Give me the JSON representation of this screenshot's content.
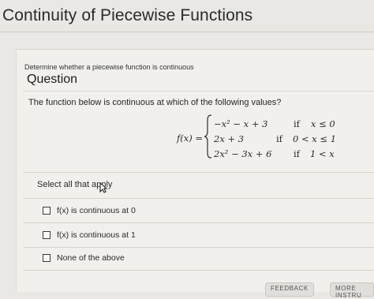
{
  "page": {
    "title": "Continuity of Piecewise Functions"
  },
  "question": {
    "instruction": "Determine whether a piecewise function is continuous",
    "heading": "Question",
    "prompt": "The function below is continuous at which of the following values?"
  },
  "math": {
    "lhs": "f(x) =",
    "pieces": [
      {
        "expr": "−x² − x + 3",
        "cond_word": "if",
        "cond": "x ≤ 0"
      },
      {
        "expr": "2x + 3",
        "cond_word": "if",
        "cond": "0 < x ≤ 1"
      },
      {
        "expr": "2x² − 3x + 6",
        "cond_word": "if",
        "cond": "1 < x"
      }
    ]
  },
  "answers": {
    "select_label": "Select all that apply",
    "options": [
      {
        "label": "f(x) is continuous at 0",
        "checked": false
      },
      {
        "label": "f(x) is continuous at 1",
        "checked": false
      },
      {
        "label": "None of the above",
        "checked": false
      }
    ]
  },
  "footer": {
    "feedback_button": "FEEDBACK",
    "more_button": "MORE INSTRU"
  }
}
